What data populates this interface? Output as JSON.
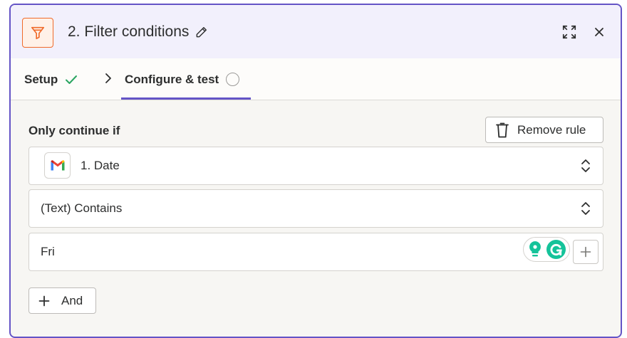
{
  "header": {
    "title": "2. Filter conditions",
    "icon": "filter-icon",
    "accent_color": "#f06a2a"
  },
  "tabs": [
    {
      "label": "Setup",
      "status": "check-icon"
    },
    {
      "label": "Configure & test",
      "status": "circle-icon",
      "active": true
    }
  ],
  "rule": {
    "section_title": "Only continue if",
    "remove_label": "Remove rule",
    "field_value": "1. Date",
    "field_app_icon": "gmail-icon",
    "condition_value": "(Text) Contains",
    "input_value": "Fri"
  },
  "and_label": "And",
  "colors": {
    "primary": "#6454c6",
    "success": "#2aa561",
    "grammarly": "#15c39a"
  }
}
